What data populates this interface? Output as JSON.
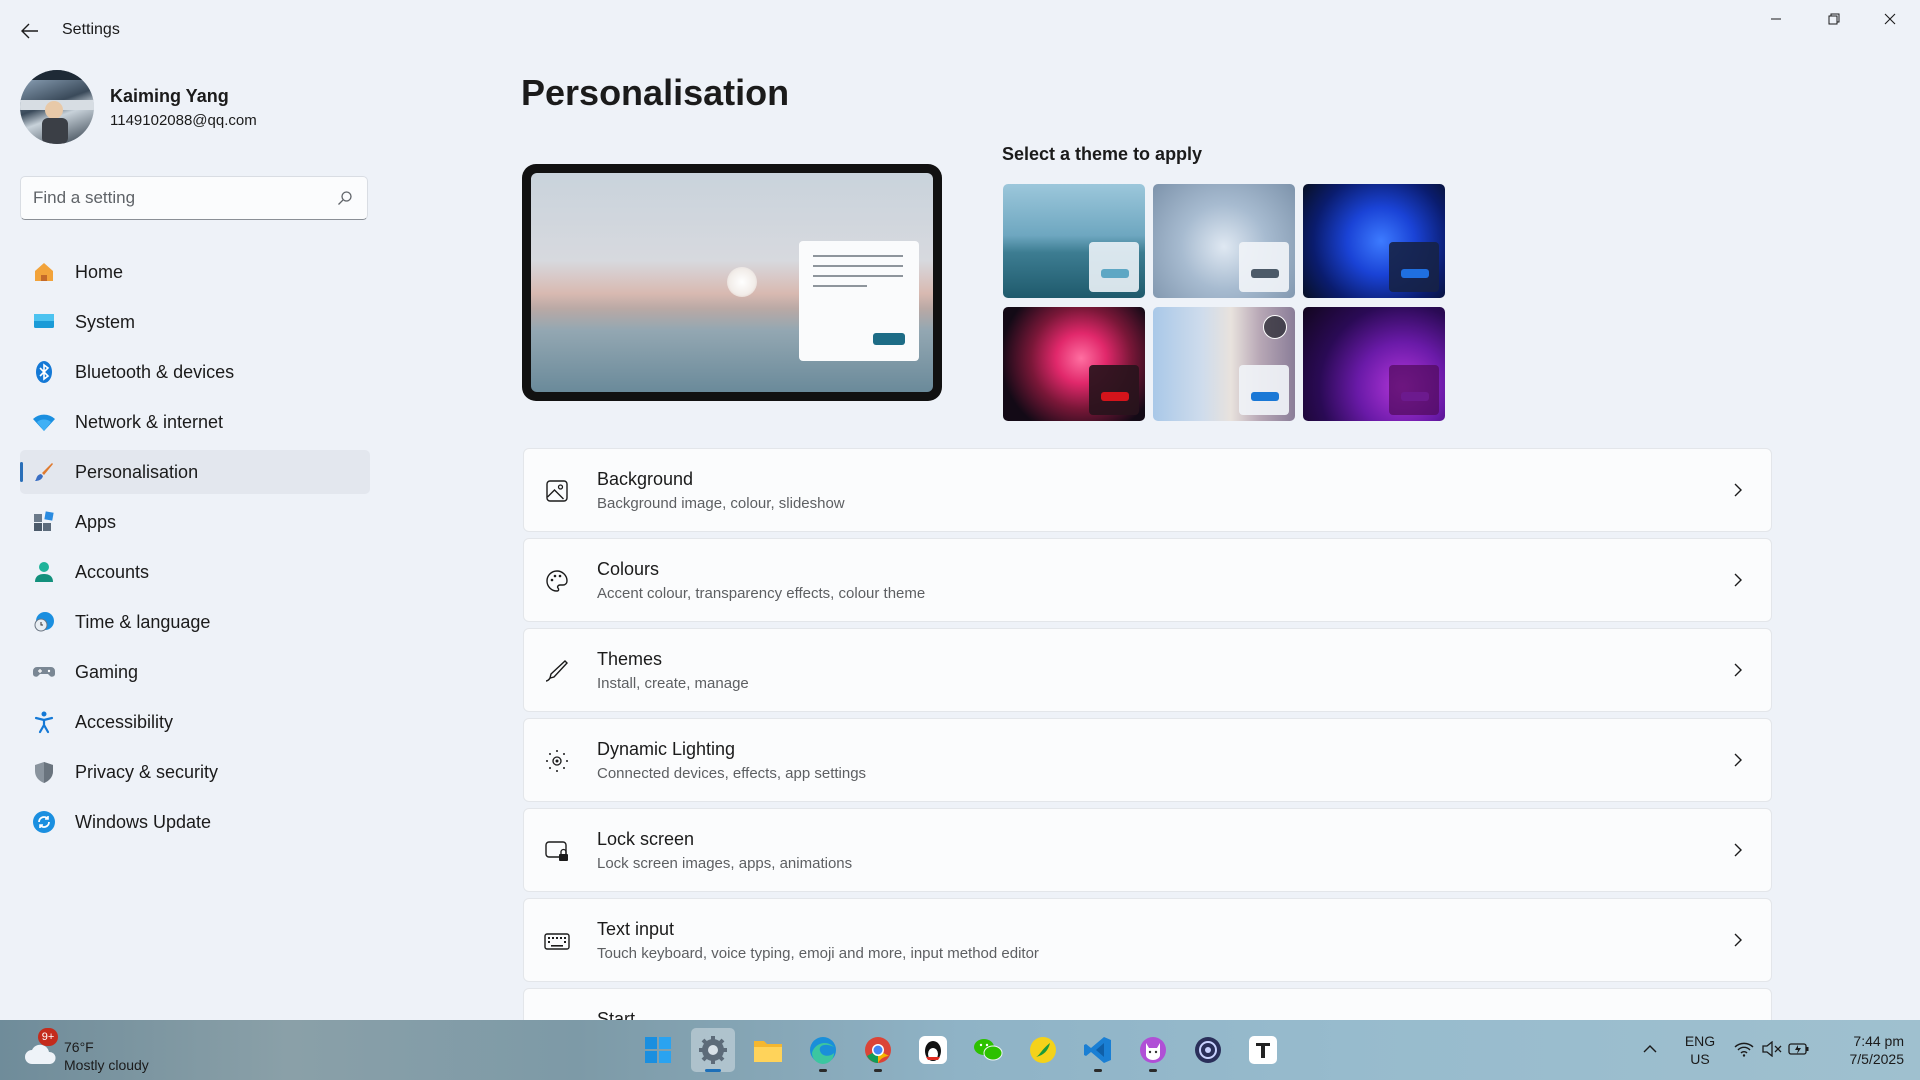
{
  "window": {
    "title": "Settings",
    "back_label": "Back",
    "minimize_label": "Minimize",
    "maximize_label": "Restore",
    "close_label": "Close"
  },
  "profile": {
    "name": "Kaiming Yang",
    "email": "1149102088@qq.com"
  },
  "search": {
    "placeholder": "Find a setting",
    "value": ""
  },
  "sidebar": {
    "items": [
      {
        "label": "Home",
        "icon": "home-icon",
        "active": false
      },
      {
        "label": "System",
        "icon": "system-icon",
        "active": false
      },
      {
        "label": "Bluetooth & devices",
        "icon": "bluetooth-icon",
        "active": false
      },
      {
        "label": "Network & internet",
        "icon": "wifi-icon",
        "active": false
      },
      {
        "label": "Personalisation",
        "icon": "brush-icon",
        "active": true
      },
      {
        "label": "Apps",
        "icon": "apps-icon",
        "active": false
      },
      {
        "label": "Accounts",
        "icon": "accounts-icon",
        "active": false
      },
      {
        "label": "Time & language",
        "icon": "clock-globe-icon",
        "active": false
      },
      {
        "label": "Gaming",
        "icon": "gamepad-icon",
        "active": false
      },
      {
        "label": "Accessibility",
        "icon": "accessibility-icon",
        "active": false
      },
      {
        "label": "Privacy & security",
        "icon": "shield-icon",
        "active": false
      },
      {
        "label": "Windows Update",
        "icon": "update-icon",
        "active": false
      }
    ]
  },
  "main": {
    "page_title": "Personalisation",
    "themes_title": "Select a theme to apply",
    "themes": [
      {
        "name": "glow-theme",
        "accent": "#5ea7c4"
      },
      {
        "name": "bloom-light-theme",
        "accent": "#4c5a68"
      },
      {
        "name": "bloom-dark-theme",
        "accent": "#1f6fe0"
      },
      {
        "name": "captured-motion-theme",
        "accent": "#d4141b"
      },
      {
        "name": "spotlight-theme",
        "accent": "#1a78d6"
      },
      {
        "name": "flow-theme",
        "accent": "#6c1a8e"
      }
    ],
    "rows": [
      {
        "title": "Background",
        "subtitle": "Background image, colour, slideshow",
        "icon": "picture-icon"
      },
      {
        "title": "Colours",
        "subtitle": "Accent colour, transparency effects, colour theme",
        "icon": "palette-icon"
      },
      {
        "title": "Themes",
        "subtitle": "Install, create, manage",
        "icon": "pen-icon"
      },
      {
        "title": "Dynamic Lighting",
        "subtitle": "Connected devices, effects, app settings",
        "icon": "lighting-icon"
      },
      {
        "title": "Lock screen",
        "subtitle": "Lock screen images, apps, animations",
        "icon": "lock-screen-icon"
      },
      {
        "title": "Text input",
        "subtitle": "Touch keyboard, voice typing, emoji and more, input method editor",
        "icon": "keyboard-icon"
      },
      {
        "title": "Start",
        "subtitle": "",
        "icon": "start-icon"
      }
    ]
  },
  "taskbar": {
    "weather_badge": "9+",
    "weather_temp": "76°F",
    "weather_desc": "Mostly cloudy",
    "apps": [
      "start-icon",
      "settings-icon",
      "file-explorer-icon",
      "edge-icon",
      "chrome-icon",
      "qq-icon",
      "wechat-icon",
      "app-icon",
      "vscode-icon",
      "cat-app-icon",
      "app-circle-icon",
      "typora-icon"
    ],
    "lang_top": "ENG",
    "lang_bottom": "US",
    "time": "7:44 pm",
    "date": "7/5/2025"
  },
  "colors": {
    "accent": "#2a6fb8",
    "background": "#eef2f8",
    "card": "#fbfcfd"
  }
}
